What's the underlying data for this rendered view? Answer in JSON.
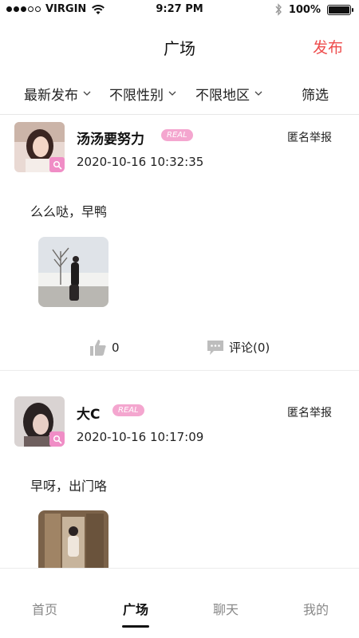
{
  "status_bar": {
    "carrier": "VIRGIN",
    "time": "9:27 PM",
    "battery": "100%",
    "battery_level": 1.0
  },
  "header": {
    "title": "广场",
    "publish_label": "发布"
  },
  "filters": [
    {
      "label": "最新发布",
      "icon": "chevron-down-icon"
    },
    {
      "label": "不限性别",
      "icon": "chevron-down-icon"
    },
    {
      "label": "不限地区",
      "icon": "chevron-down-icon"
    },
    {
      "label": "筛选"
    }
  ],
  "posts": [
    {
      "username": "汤汤要努力",
      "badge": "REAL",
      "time": "2020-10-16 10:32:35",
      "report_label": "匿名举报",
      "text": "么么哒，早鸭",
      "likes": "0",
      "comment_label": "评论(0)"
    },
    {
      "username": "大C",
      "badge": "REAL",
      "time": "2020-10-16 10:17:09",
      "report_label": "匿名举报",
      "text": "早呀，出门咯"
    }
  ],
  "tabs": [
    {
      "label": "首页"
    },
    {
      "label": "广场"
    },
    {
      "label": "聊天"
    },
    {
      "label": "我的"
    }
  ],
  "colors": {
    "accent": "#ee4d4d",
    "badge_pink": "#f4a6cf",
    "avatar_badge": "#f08dc6"
  }
}
